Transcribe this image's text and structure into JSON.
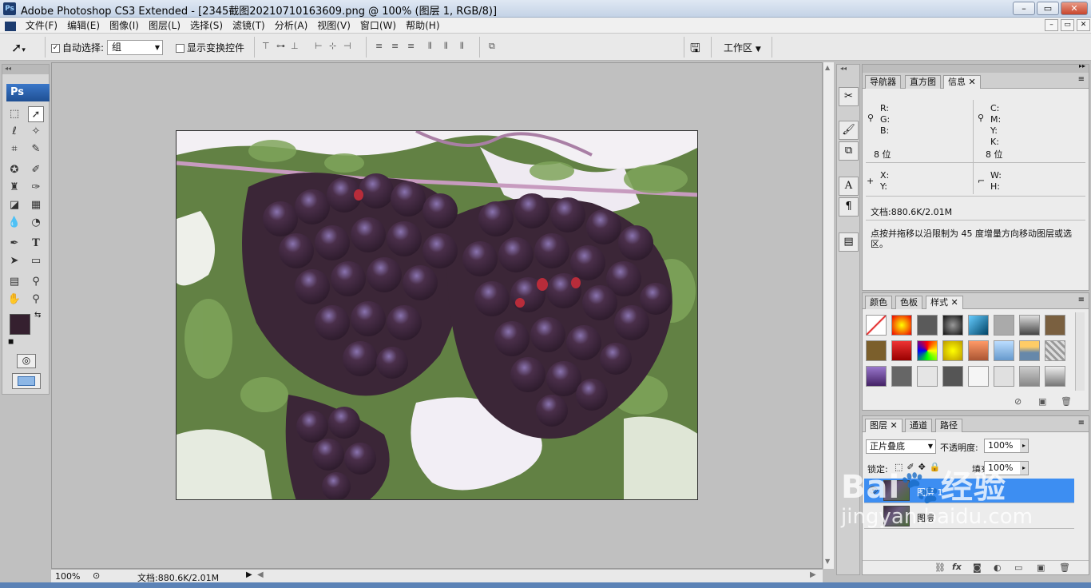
{
  "window": {
    "title": "Adobe Photoshop CS3 Extended - [2345截图20210710163609.png @ 100% (图层 1, RGB/8)]",
    "app_icon": "Ps",
    "minimize": "–",
    "restore": "▭",
    "close": "✕"
  },
  "menu": [
    "文件(F)",
    "编辑(E)",
    "图像(I)",
    "图层(L)",
    "选择(S)",
    "滤镜(T)",
    "分析(A)",
    "视图(V)",
    "窗口(W)",
    "帮助(H)"
  ],
  "options": {
    "auto_select_label": "自动选择:",
    "auto_select_value": "组",
    "show_transform_label": "显示变换控件",
    "workspace_label": "工作区"
  },
  "tools": {
    "logo": "Ps"
  },
  "status": {
    "zoom": "100%",
    "doc": "文档:880.6K/2.01M"
  },
  "info_panel": {
    "tabs": [
      "导航器",
      "直方图",
      "信息"
    ],
    "rgb_labels": [
      "R:",
      "G:",
      "B:"
    ],
    "cmyk_labels": [
      "C:",
      "M:",
      "Y:",
      "K:"
    ],
    "bits_left": "8 位",
    "bits_right": "8 位",
    "xy_labels": [
      "X:",
      "Y:"
    ],
    "wh_labels": [
      "W:",
      "H:"
    ],
    "doc": "文档:880.6K/2.01M",
    "hint": "点按并拖移以沿限制为 45 度增量方向移动图层或选区。"
  },
  "styles_panel": {
    "tabs": [
      "颜色",
      "色板",
      "样式"
    ]
  },
  "layers_panel": {
    "tabs": [
      "图层",
      "通道",
      "路径"
    ],
    "blend_mode": "正片叠底",
    "opacity_label": "不透明度:",
    "opacity_value": "100%",
    "lock_label": "锁定:",
    "fill_label": "填充:",
    "fill_value": "100%",
    "layers": [
      "图层 1",
      "图层"
    ]
  },
  "watermark": {
    "brand": "Bai",
    "brand2": "经验",
    "url": "jingyan.baidu.com"
  },
  "colors": {
    "foreground": "#35202f",
    "background": "#ffffff",
    "selected_layer": "#3d8ef2"
  }
}
